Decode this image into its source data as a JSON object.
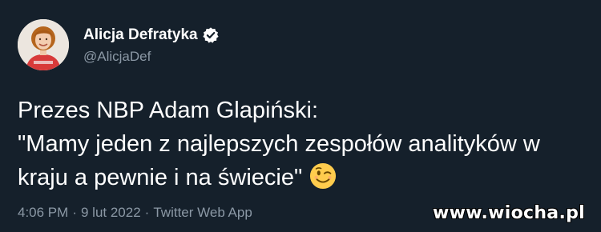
{
  "author": {
    "display_name": "Alicja Defratyka",
    "handle": "@AlicjaDef",
    "verified": true
  },
  "tweet": {
    "lines": [
      "Prezes NBP Adam Glapiński:",
      "\"Mamy jeden z najlepszych zespołów analityków w",
      "kraju a pewnie i na świecie\""
    ],
    "emoji": "winking-face-emoji"
  },
  "meta": {
    "time": "4:06 PM",
    "separator": "·",
    "date": "9 lut 2022",
    "source": "Twitter Web App"
  },
  "watermark": "www.wiocha.pl",
  "colors": {
    "background": "#15202b",
    "text_primary": "#ffffff",
    "text_secondary": "#8b98a5",
    "verified_badge": "#ffffff"
  }
}
